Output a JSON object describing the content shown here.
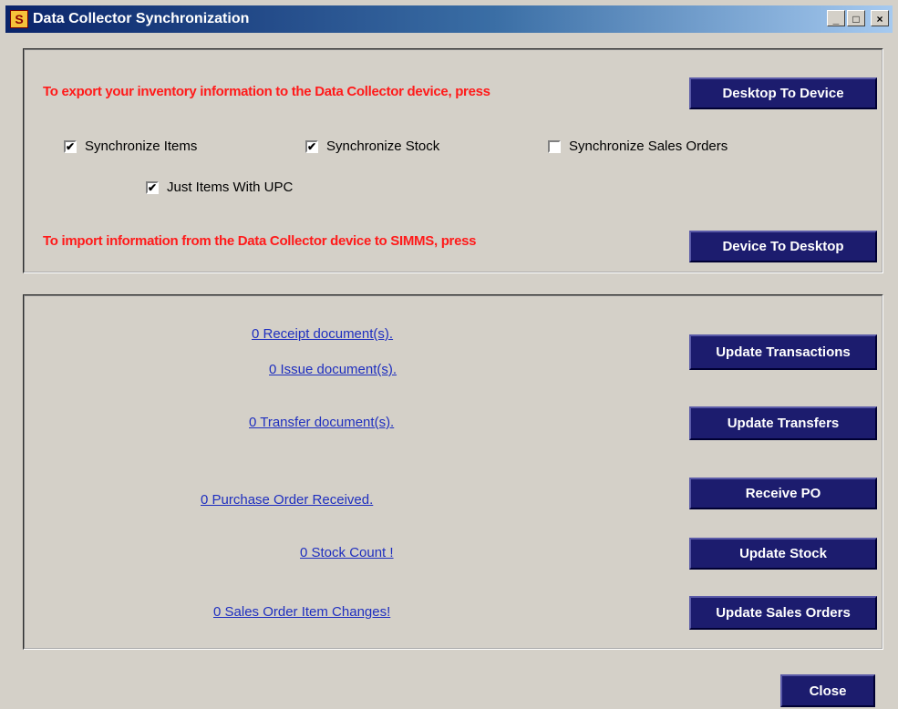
{
  "window": {
    "title": "Data Collector Synchronization",
    "icon_letter": "S",
    "controls": {
      "minimize": "_",
      "maximize": "□",
      "close": "×"
    }
  },
  "export_section": {
    "instruction": "To export your inventory information to the Data Collector device, press",
    "button_label": "Desktop To Device",
    "checkboxes": [
      {
        "label": "Synchronize Items",
        "checked": true,
        "mark": "✔"
      },
      {
        "label": "Synchronize Stock",
        "checked": true,
        "mark": "✔"
      },
      {
        "label": "Synchronize Sales Orders",
        "checked": false,
        "mark": ""
      },
      {
        "label": "Just Items With UPC",
        "checked": true,
        "mark": "✔"
      }
    ]
  },
  "import_section": {
    "instruction": "To import information from the Data Collector device to SIMMS, press",
    "button_label": "Device To Desktop"
  },
  "updates": {
    "receipt_link": "0 Receipt document(s).",
    "issue_link": "0 Issue document(s).",
    "transactions_button": "Update Transactions",
    "transfer_link": "0 Transfer document(s).",
    "transfers_button": "Update Transfers",
    "po_link": "0 Purchase Order Received.",
    "po_button": "Receive PO",
    "stock_link": "0  Stock Count !",
    "stock_button": "Update Stock",
    "sales_link": "0 Sales Order Item Changes!",
    "sales_button": "Update Sales Orders"
  },
  "footer": {
    "close_label": "Close"
  },
  "colors": {
    "window_bg": "#d4d0c8",
    "button_bg": "#1c1c6e",
    "instruction_text": "#ff1a1a",
    "link_text": "#1f2fbf"
  }
}
